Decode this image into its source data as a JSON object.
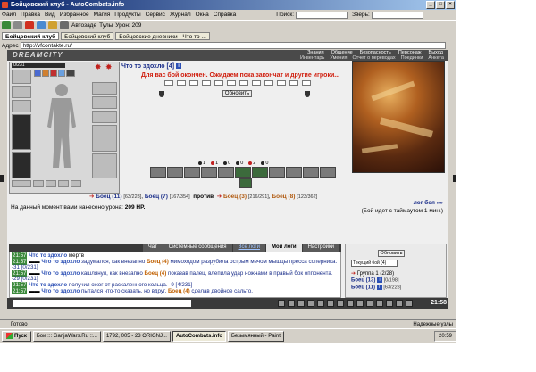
{
  "window": {
    "title": "Бойцовский клуб - AutoCombats.info"
  },
  "menu": {
    "items": [
      "Файл",
      "Правка",
      "Вид",
      "Избранное",
      "Магия",
      "Продукты",
      "Сервис",
      "Журнал",
      "Окна",
      "Справка"
    ],
    "search_label": "Поиск:",
    "beast_label": "Зверь:"
  },
  "toolbar": {
    "autofill": "Автозаде",
    "tools": "Тулы",
    "urls": "Урон: 209"
  },
  "tabs": [
    "Бойцовский клуб",
    "Бойцовский клуб",
    "Бойцовские дневники - Что то ..."
  ],
  "address": {
    "label": "Адрес",
    "url": "http://vfcontakte.ru/"
  },
  "site": {
    "logo": "DREAMCITY",
    "nav_top": [
      "Знания",
      "Общение",
      "Безопасность",
      "Персонаж",
      "Выход"
    ],
    "nav_bottom": [
      "Инвентарь",
      "Умения",
      "Отчет о переводах",
      "Поединки",
      "Анкета"
    ]
  },
  "character": {
    "level_bar": "0/231"
  },
  "battle": {
    "player": "Что то здохло [4]",
    "wait_message": "Для вас бой окончен. Ожидаем пока закончат и другие игроки...",
    "refresh_button": "Обновить",
    "counters": [
      "1",
      "1",
      "0",
      "0",
      "2",
      "0"
    ],
    "vs": {
      "left": [
        "Боец (11)",
        "Боец (7)"
      ],
      "left_hp": [
        "[63/228]",
        "[167/354]"
      ],
      "versus": "против",
      "right": [
        "Боец (3)",
        "Боец (8)"
      ],
      "right_hp": [
        "[216/291]",
        "[123/362]"
      ]
    },
    "damage_label": "На данный момент вами нанесено урона:",
    "damage_value": "209 HP.",
    "log_link": "лог боя »»",
    "timeout": "(Бой идет с таймаутом 1 мин.)"
  },
  "chat": {
    "tabs": [
      "Чат",
      "Системные сообщения",
      "Все логи",
      "Мои логи",
      "Настройки"
    ],
    "active_tab": "Мои логи",
    "lines": [
      {
        "time": "21:57",
        "name": "Что то здохло",
        "text": " мертв"
      },
      {
        "time": "21:57",
        "name": "Что то здохло",
        "text": " задумался, как внезапно ",
        "hit": "Боец (4)",
        "rest": " мимоходом разрубила острым мечом мышцы пресса соперника. -31 [0/231]"
      },
      {
        "time": "21:57",
        "name": "Что то здохло",
        "text": " кашлянул, как внезапно ",
        "hit": "Боец (4)",
        "rest": " показав палец, влепила удар ножнами в правый бок оппонента. -29 [0/231]"
      },
      {
        "time": "21:57",
        "name": "Что то здохло",
        "text": " получил ожог от раскаленного кольца. -9 [4/231]"
      },
      {
        "time": "21:57",
        "name": "Что то здохло",
        "text": " пытался что-то сказать, но вдруг, ",
        "hit": "Боец (4)",
        "rest": " сделав двойное сальто,"
      }
    ]
  },
  "right_panel": {
    "refresh": "Обновить",
    "select": "Текущий бой (4)",
    "group_label": "Группа 1 (2/28)",
    "line1_name": "Боец (13)",
    "line1_hp": "[0/198]",
    "line2_name": "Боец (11)",
    "line2_hp": "[63/228]"
  },
  "pagebar": {
    "clock": "21:58"
  },
  "status": {
    "text": "Готово",
    "zone": "Надежные узлы"
  },
  "taskbar": {
    "start": "Пуск",
    "tasks": [
      "Бои ::: GanjaWars.Ru ::...",
      "1792, 005 - 23 ORIGNJ...",
      "AutoCombats.info",
      "Безымянный - Paint"
    ],
    "active_task": "AutoCombats.info",
    "clock": "20:59"
  },
  "colors": {
    "accent_blue": "#1a2e8a",
    "alert_red": "#d02010",
    "fighter_orange": "#b05a10",
    "chat_time_green": "#3d8a3d"
  }
}
